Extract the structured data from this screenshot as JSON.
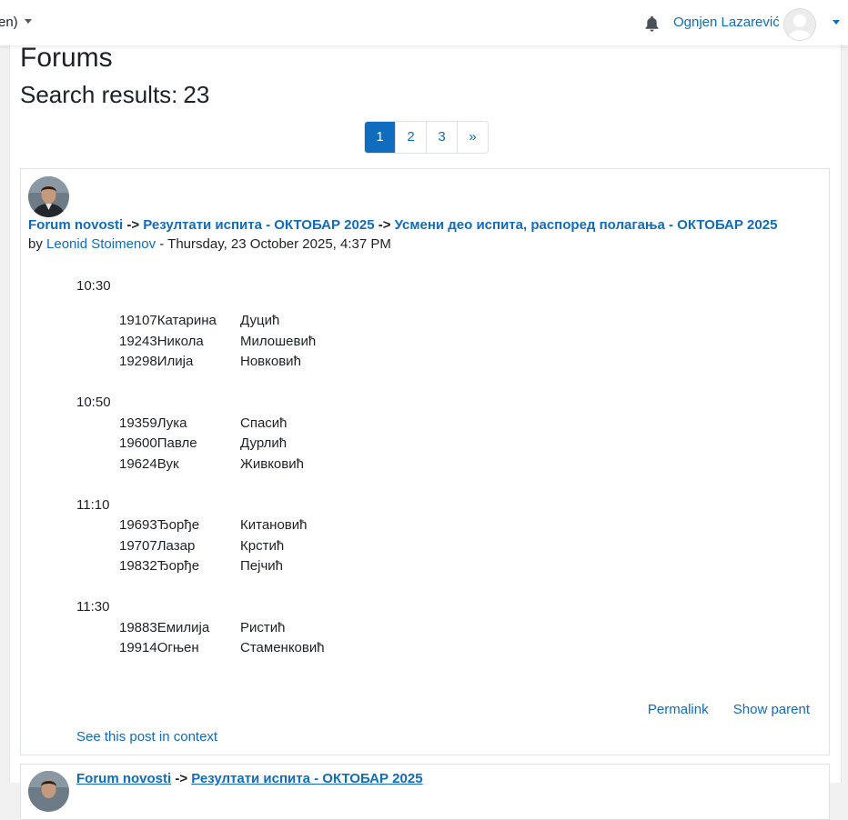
{
  "navbar": {
    "language_label": "en)",
    "username": "Ognjen Lazarević"
  },
  "page": {
    "title": "Forums",
    "search_results_label": "Search results:",
    "search_results_count": "23"
  },
  "pagination": {
    "pages": [
      "1",
      "2",
      "3"
    ],
    "next": "»",
    "active_page": "1"
  },
  "post": {
    "forum": "Forum novosti",
    "separator": "->",
    "discussion": "Резултати испита - ОКТОБАР 2025",
    "subject": "Усмени део испита, распоред полагања - ОКТОБАР 2025",
    "by_label": "by",
    "author": "Leonid Stoimenov",
    "date": "- Thursday, 23 October 2025, 4:37 PM",
    "schedule": [
      {
        "time": "10:30",
        "entries": [
          {
            "id_first": "19107Катарина",
            "last": "Дуцић"
          },
          {
            "id_first": "19243Никола",
            "last": "Милошевић"
          },
          {
            "id_first": "19298Илија",
            "last": "Новковић"
          }
        ]
      },
      {
        "time": "10:50",
        "entries": [
          {
            "id_first": "19359Лука",
            "last": "Спасић"
          },
          {
            "id_first": "19600Павле",
            "last": "Дурлић"
          },
          {
            "id_first": "19624Вук",
            "last": "Живковић"
          }
        ]
      },
      {
        "time": "11:10",
        "entries": [
          {
            "id_first": "19693Ђорђе",
            "last": "Китановић"
          },
          {
            "id_first": "19707Лазар",
            "last": "Крстић"
          },
          {
            "id_first": "19832Ђорђе",
            "last": "Пејчић"
          }
        ]
      },
      {
        "time": "11:30",
        "entries": [
          {
            "id_first": "19883Емилија",
            "last": "Ристић"
          },
          {
            "id_first": "19914Огњен",
            "last": "Стаменковић"
          }
        ]
      }
    ],
    "permalink_label": "Permalink",
    "show_parent_label": "Show parent",
    "context_label": "See this post in context"
  },
  "post2": {
    "forum": "Forum novosti",
    "separator": "->",
    "discussion": "Резултати испита - ОКТОБАР 2025"
  },
  "colors": {
    "link": "#0f6cbf",
    "active_page_bg": "#0f6cbf",
    "border": "#dee2e6",
    "background": "#f1f1f1"
  }
}
